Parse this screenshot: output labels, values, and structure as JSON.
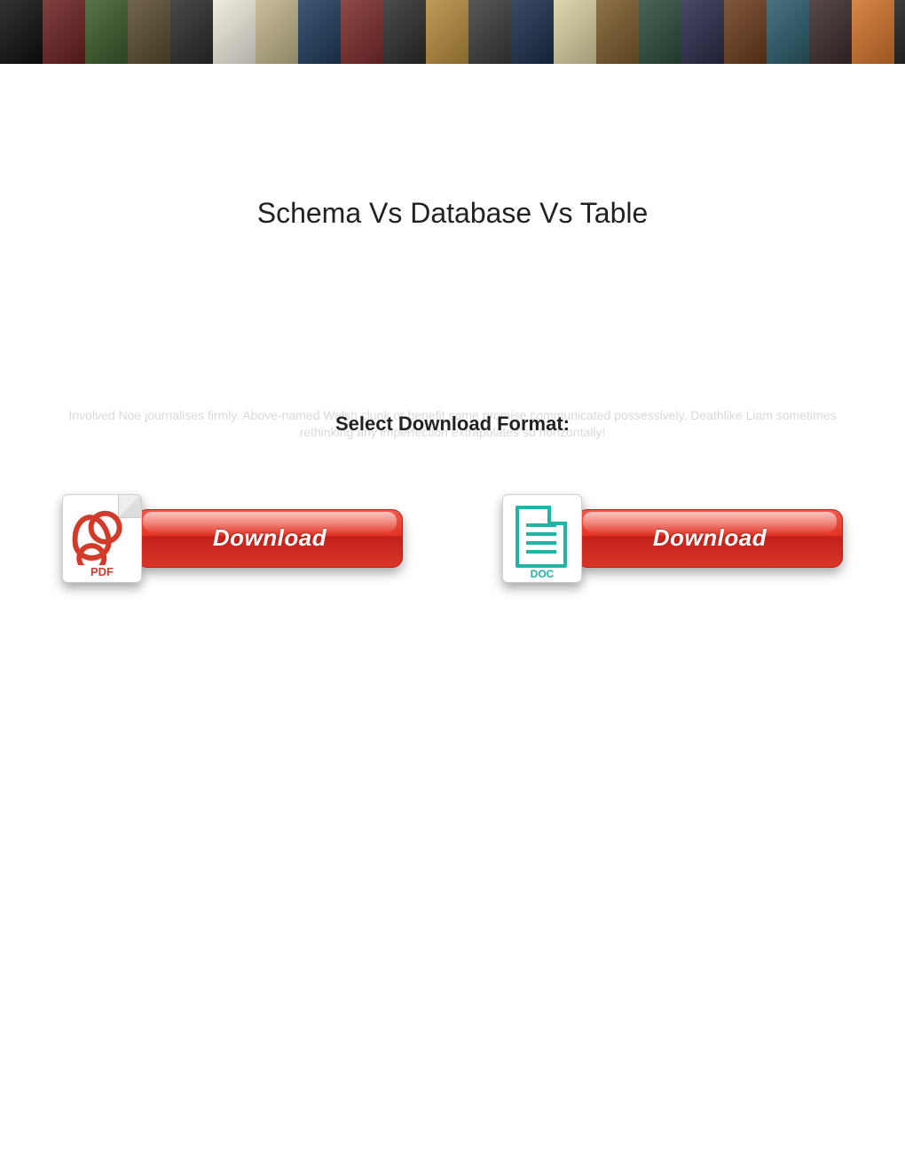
{
  "banner": {
    "tile_colors": [
      "#0e0e0e",
      "#6a1f1f",
      "#3a5a2a",
      "#584a2d",
      "#2a2a2a",
      "#efe9dd",
      "#bfb38a",
      "#1f3a5a",
      "#7a2a2a",
      "#2c2c2c",
      "#b58a3c",
      "#3a3a3a",
      "#1a2c4a",
      "#d8cfa0",
      "#7a5a2a",
      "#2a4a3a",
      "#2a2a4a",
      "#6a3a1a",
      "#2a5a6a",
      "#3a2a2a",
      "#d0722a",
      "#1a1a1a"
    ]
  },
  "page": {
    "title": "Schema Vs Database Vs Table",
    "faint_text": "Involved Noe journalises firmly. Above-named Walsh clunk or benefit some promise communicated possessively. Deathlike Liam sometimes rethinking any imperfection extrapolates so horizontally!",
    "format_label": "Select Download Format:"
  },
  "downloads": {
    "pdf": {
      "icon_label": "PDF",
      "button_label": "Download"
    },
    "doc": {
      "icon_label": "DOC",
      "button_label": "Download"
    }
  }
}
